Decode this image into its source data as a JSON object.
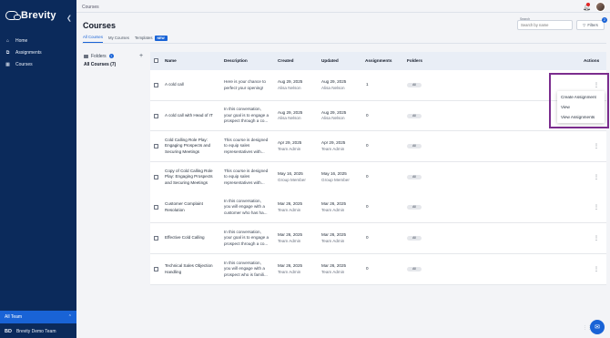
{
  "app": {
    "name": "Brevity"
  },
  "sidebar": {
    "items": [
      {
        "label": "Home",
        "icon": "home-icon"
      },
      {
        "label": "Assignments",
        "icon": "assignments-icon"
      },
      {
        "label": "Courses",
        "icon": "book-icon"
      }
    ],
    "team_selector": "All Team",
    "team_initials": "BD",
    "team_name": "Brevity Demo Team"
  },
  "header": {
    "breadcrumb": "Courses",
    "page_title": "Courses",
    "notification_count": "1"
  },
  "tabs": [
    {
      "label": "All Courses",
      "active": true
    },
    {
      "label": "My Courses",
      "active": false
    },
    {
      "label": "Templates",
      "active": false,
      "badge": "NEW"
    }
  ],
  "search": {
    "label": "Search",
    "placeholder": "Search by name"
  },
  "filters": {
    "label": "Filters",
    "count": "2"
  },
  "folders": {
    "label": "Folders",
    "all_courses_label": "All Courses (7)"
  },
  "table": {
    "columns": [
      "Name",
      "Description",
      "Created",
      "Updated",
      "Assignments",
      "Folders",
      "Actions"
    ],
    "rows": [
      {
        "name": [
          "A cold call"
        ],
        "description": [
          "Here is your chance to",
          "perfect your opening!"
        ],
        "created": "Aug 29, 2025",
        "created_by": "Alisa Nelson",
        "updated": "Aug 29, 2025",
        "updated_by": "Alisa Nelson",
        "assignments": "1",
        "folder": "All"
      },
      {
        "name": [
          "A cold call with Head of IT"
        ],
        "description": [
          "In this conversation,",
          "your goal is to engage a",
          "prospect through a co..."
        ],
        "created": "Aug 29, 2025",
        "created_by": "Alisa Nelson",
        "updated": "Aug 29, 2025",
        "updated_by": "Alisa Nelson",
        "assignments": "0",
        "folder": "All"
      },
      {
        "name": [
          "Cold Calling Role Play:",
          "Engaging Prospects and",
          "Securing Meetings"
        ],
        "description": [
          "This course is designed",
          "to equip sales",
          "representatives with..."
        ],
        "created": "Apr 29, 2025",
        "created_by": "Team Admin",
        "updated": "Apr 29, 2025",
        "updated_by": "Team Admin",
        "assignments": "0",
        "folder": "All"
      },
      {
        "name": [
          "Copy of Cold Calling Role",
          "Play: Engaging Prospects",
          "and Securing Meetings"
        ],
        "description": [
          "This course is designed",
          "to equip sales",
          "representatives with..."
        ],
        "created": "May 16, 2025",
        "created_by": "Group Member",
        "updated": "May 16, 2025",
        "updated_by": "Group Member",
        "assignments": "0",
        "folder": "All"
      },
      {
        "name": [
          "Customer Complaint",
          "Resolution"
        ],
        "description": [
          "In this conversation,",
          "you will engage with a",
          "customer who has ha..."
        ],
        "created": "Mar 26, 2025",
        "created_by": "Team Admin",
        "updated": "Mar 26, 2025",
        "updated_by": "Team Admin",
        "assignments": "0",
        "folder": "All"
      },
      {
        "name": [
          "Effective Cold Calling"
        ],
        "description": [
          "In this conversation,",
          "your goal is to engage a",
          "prospect through a co..."
        ],
        "created": "Mar 26, 2025",
        "created_by": "Team Admin",
        "updated": "Mar 26, 2025",
        "updated_by": "Team Admin",
        "assignments": "0",
        "folder": "All"
      },
      {
        "name": [
          "Technical Sales Objection",
          "Handling"
        ],
        "description": [
          "In this conversation,",
          "you will engage with a",
          "prospect who is famili..."
        ],
        "created": "Mar 26, 2025",
        "created_by": "Team Admin",
        "updated": "Mar 26, 2025",
        "updated_by": "Team Admin",
        "assignments": "0",
        "folder": "All"
      }
    ]
  },
  "action_menu": {
    "items": [
      "Create Assignment",
      "View",
      "View Assignments"
    ]
  },
  "colors": {
    "sidebar": "#0b2a5b",
    "accent": "#1963d6",
    "highlight": "#7b2d8e"
  }
}
